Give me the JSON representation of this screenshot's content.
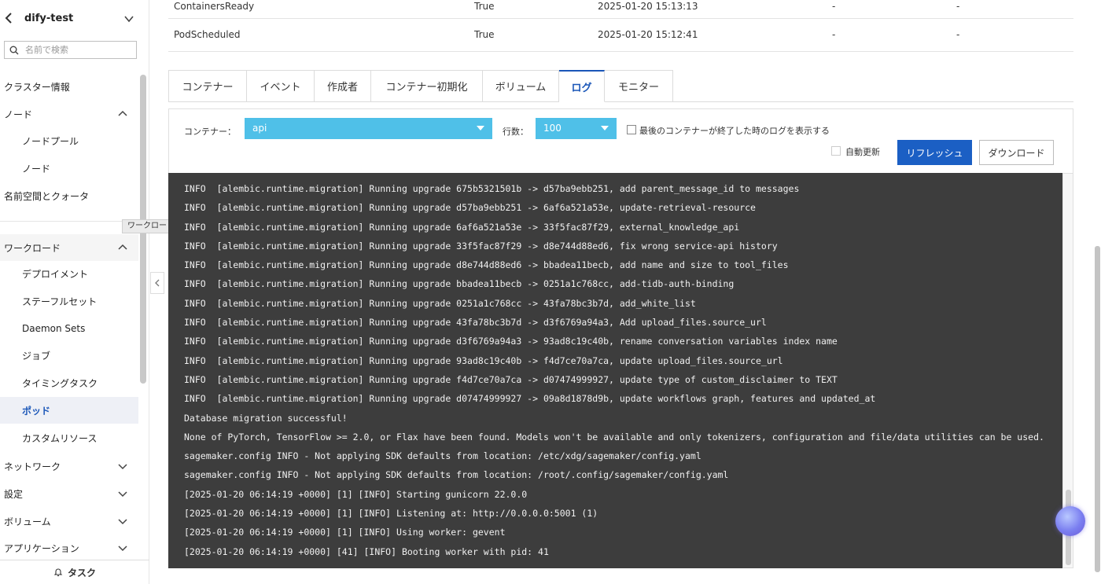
{
  "sidebar": {
    "title": "dify-test",
    "search_placeholder": "名前で検索",
    "items": [
      {
        "label": "クラスター情報"
      },
      {
        "label": "ノード"
      },
      {
        "label": "ノードプール"
      },
      {
        "label": "ノード"
      },
      {
        "label": "名前空間とクォータ"
      },
      {
        "label": "ワークロード"
      },
      {
        "label": "デプロイメント"
      },
      {
        "label": "ステーフルセット"
      },
      {
        "label": "Daemon Sets"
      },
      {
        "label": "ジョブ"
      },
      {
        "label": "タイミングタスク"
      },
      {
        "label": "ポッド"
      },
      {
        "label": "カスタムリソース"
      },
      {
        "label": "ネットワーク"
      },
      {
        "label": "設定"
      },
      {
        "label": "ボリューム"
      },
      {
        "label": "アプリケーション"
      }
    ],
    "footer": "タスク",
    "tooltip": "ワークロード"
  },
  "conditions": [
    {
      "type": "ContainersReady",
      "status": "True",
      "time": "2025-01-20 15:13:13",
      "reason": "-",
      "message": "-"
    },
    {
      "type": "PodScheduled",
      "status": "True",
      "time": "2025-01-20 15:12:41",
      "reason": "-",
      "message": "-"
    }
  ],
  "tabs": [
    {
      "label": "コンテナー"
    },
    {
      "label": "イベント"
    },
    {
      "label": "作成者"
    },
    {
      "label": "コンテナー初期化"
    },
    {
      "label": "ボリューム"
    },
    {
      "label": "ログ"
    },
    {
      "label": "モニター"
    }
  ],
  "controls": {
    "container_label": "コンテナー：",
    "container_value": "api",
    "lines_label": "行数：",
    "lines_value": "100",
    "previous_label": "最後のコンテナーが終了した時のログを表示する",
    "auto_refresh_label": "自動更新",
    "refresh_button": "リフレッシュ",
    "download_button": "ダウンロード"
  },
  "log_lines": [
    "INFO  [alembic.runtime.migration] Running upgrade 675b5321501b -> d57ba9ebb251, add parent_message_id to messages",
    "INFO  [alembic.runtime.migration] Running upgrade d57ba9ebb251 -> 6af6a521a53e, update-retrieval-resource",
    "INFO  [alembic.runtime.migration] Running upgrade 6af6a521a53e -> 33f5fac87f29, external_knowledge_api",
    "INFO  [alembic.runtime.migration] Running upgrade 33f5fac87f29 -> d8e744d88ed6, fix wrong service-api history",
    "INFO  [alembic.runtime.migration] Running upgrade d8e744d88ed6 -> bbadea11becb, add name and size to tool_files",
    "INFO  [alembic.runtime.migration] Running upgrade bbadea11becb -> 0251a1c768cc, add-tidb-auth-binding",
    "INFO  [alembic.runtime.migration] Running upgrade 0251a1c768cc -> 43fa78bc3b7d, add_white_list",
    "INFO  [alembic.runtime.migration] Running upgrade 43fa78bc3b7d -> d3f6769a94a3, Add upload_files.source_url",
    "INFO  [alembic.runtime.migration] Running upgrade d3f6769a94a3 -> 93ad8c19c40b, rename conversation variables index name",
    "INFO  [alembic.runtime.migration] Running upgrade 93ad8c19c40b -> f4d7ce70a7ca, update upload_files.source_url",
    "INFO  [alembic.runtime.migration] Running upgrade f4d7ce70a7ca -> d07474999927, update type of custom_disclaimer to TEXT",
    "INFO  [alembic.runtime.migration] Running upgrade d07474999927 -> 09a8d1878d9b, update workflows graph, features and updated_at",
    "Database migration successful!",
    "None of PyTorch, TensorFlow >= 2.0, or Flax have been found. Models won't be available and only tokenizers, configuration and file/data utilities can be used.",
    "sagemaker.config INFO - Not applying SDK defaults from location: /etc/xdg/sagemaker/config.yaml",
    "sagemaker.config INFO - Not applying SDK defaults from location: /root/.config/sagemaker/config.yaml",
    "[2025-01-20 06:14:19 +0000] [1] [INFO] Starting gunicorn 22.0.0",
    "[2025-01-20 06:14:19 +0000] [1] [INFO] Listening at: http://0.0.0.0:5001 (1)",
    "[2025-01-20 06:14:19 +0000] [1] [INFO] Using worker: gevent",
    "[2025-01-20 06:14:19 +0000] [41] [INFO] Booting worker with pid: 41"
  ]
}
